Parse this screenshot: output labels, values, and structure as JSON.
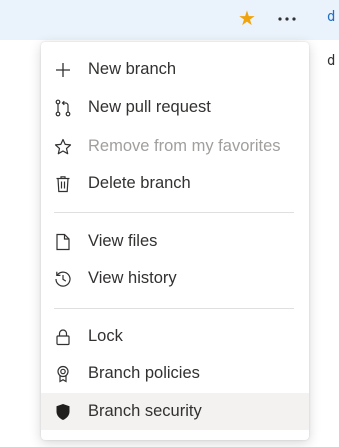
{
  "toolbar": {
    "favorite_icon": "star-filled-icon",
    "more_icon": "more-horizontal-icon",
    "star_color": "#f0a30a",
    "edge_text_top": "d",
    "edge_text_mid": "d"
  },
  "menu": {
    "items": [
      {
        "label": "New branch",
        "icon": "plus-icon",
        "enabled": true
      },
      {
        "label": "New pull request",
        "icon": "pull-request-icon",
        "enabled": true
      },
      {
        "label": "Remove from my favorites",
        "icon": "star-outline-icon",
        "enabled": false
      },
      {
        "label": "Delete branch",
        "icon": "trash-icon",
        "enabled": true
      },
      {
        "label": "View files",
        "icon": "file-icon",
        "enabled": true
      },
      {
        "label": "View history",
        "icon": "history-icon",
        "enabled": true
      },
      {
        "label": "Lock",
        "icon": "lock-icon",
        "enabled": true
      },
      {
        "label": "Branch policies",
        "icon": "badge-icon",
        "enabled": true
      },
      {
        "label": "Branch security",
        "icon": "shield-icon",
        "enabled": true,
        "highlighted": true
      }
    ]
  }
}
